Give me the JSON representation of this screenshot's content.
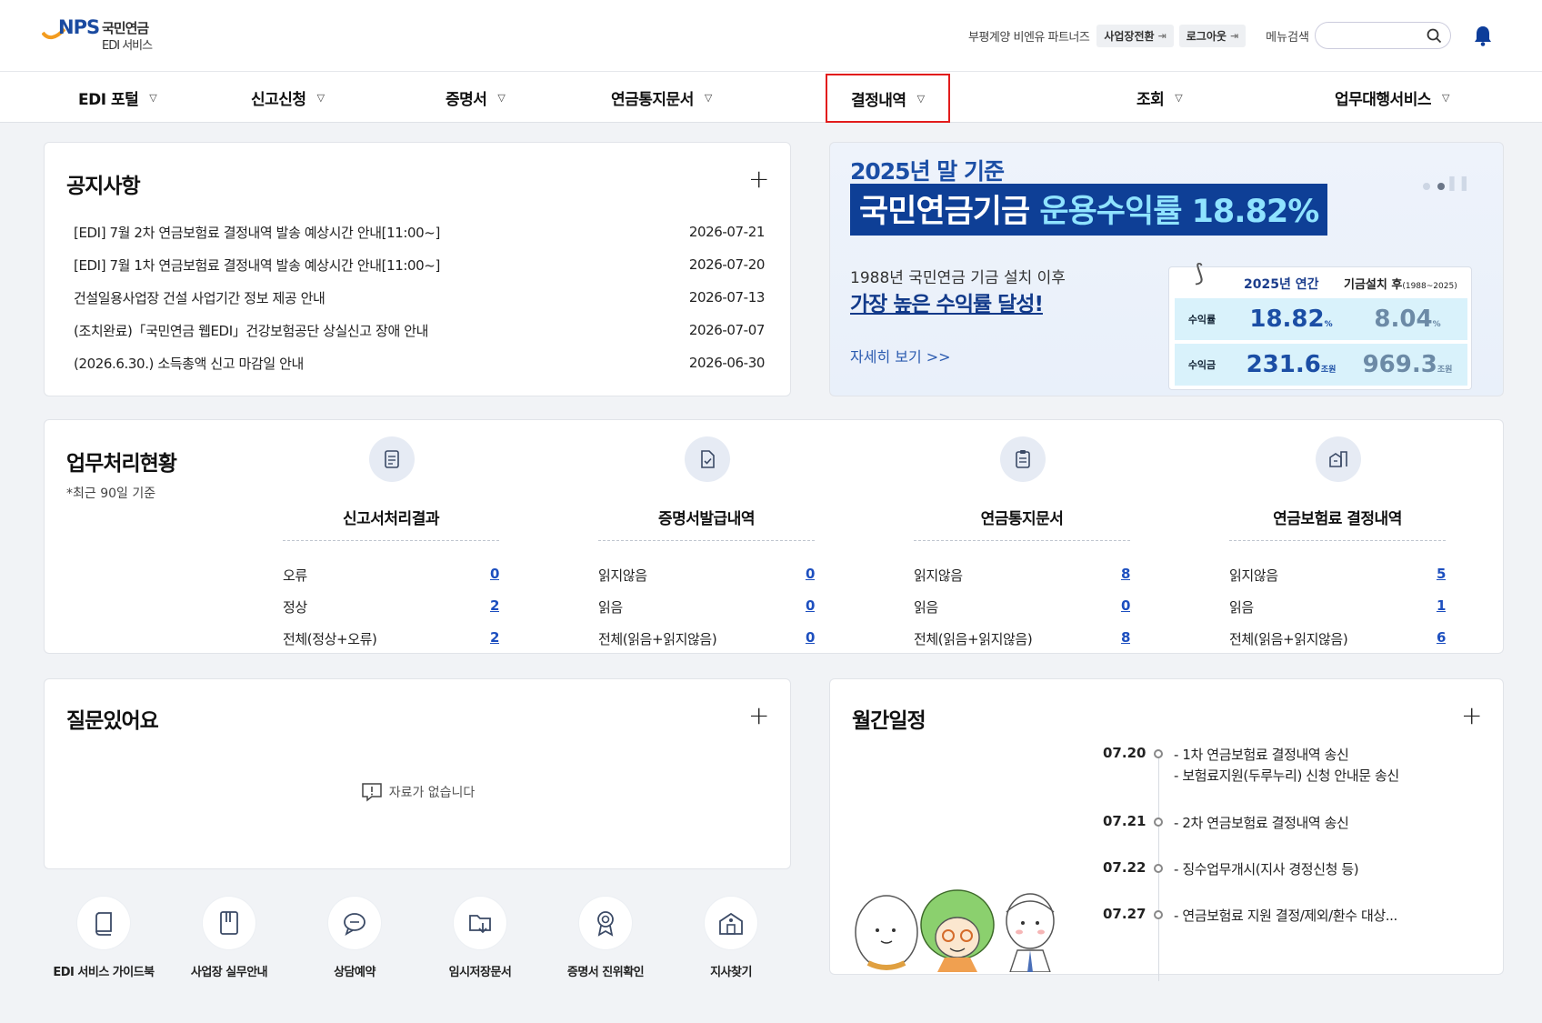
{
  "header": {
    "logo_brand": "NPS",
    "logo_name": "국민연금",
    "logo_sub": "EDI 서비스",
    "user_label": "부평계양 비엔유 파트너즈",
    "switch_workplace": "사업장전환",
    "logout": "로그아웃",
    "menu_search_label": "메뉴검색",
    "search_placeholder": ""
  },
  "nav": {
    "items": [
      {
        "label": "EDI 포털"
      },
      {
        "label": "신고신청"
      },
      {
        "label": "증명서"
      },
      {
        "label": "연금통지문서"
      },
      {
        "label": "결정내역"
      },
      {
        "label": "조회"
      },
      {
        "label": "업무대행서비스"
      }
    ],
    "active_index": 4
  },
  "notice": {
    "title": "공지사항",
    "items": [
      {
        "text": "[EDI] 7월 2차 연금보험료 결정내역 발송 예상시간 안내[11:00~]",
        "date": "2026-07-21"
      },
      {
        "text": "[EDI] 7월 1차 연금보험료 결정내역 발송 예상시간 안내[11:00~]",
        "date": "2026-07-20"
      },
      {
        "text": "건설일용사업장 건설 사업기간 정보 제공 안내",
        "date": "2026-07-13"
      },
      {
        "text": "(조치완료)「국민연금 웹EDI」건강보험공단 상실신고 장애 안내",
        "date": "2026-07-07"
      },
      {
        "text": "(2026.6.30.) 소득총액 신고 마감일 안내",
        "date": "2026-06-30"
      }
    ]
  },
  "banner": {
    "top": "2025년 말 기준",
    "head_a": "국민연금기금 ",
    "head_b": "운용수익률 18.82%",
    "sub": "1988년 국민연금 기금 설치 이후",
    "big": "가장 높은 수익률 달성!",
    "more": "자세히 보기 >>",
    "stat_h1": "2025년 연간",
    "stat_h2": "기금설치 후",
    "stat_h2_small": "(1988~2025)",
    "rows": [
      {
        "label": "수익률",
        "v1": "18.82",
        "u1": "%",
        "v2": "8.04",
        "u2": "%"
      },
      {
        "label": "수익금",
        "v1": "231.6",
        "u1": "조원",
        "v2": "969.3",
        "u2": "조원"
      }
    ]
  },
  "status": {
    "title": "업무처리현황",
    "sub": "*최근 90일 기준",
    "columns": [
      {
        "title": "신고서처리결과",
        "rows": [
          {
            "k": "오류",
            "v": "0"
          },
          {
            "k": "정상",
            "v": "2"
          },
          {
            "k": "전체(정상+오류)",
            "v": "2"
          }
        ]
      },
      {
        "title": "증명서발급내역",
        "rows": [
          {
            "k": "읽지않음",
            "v": "0"
          },
          {
            "k": "읽음",
            "v": "0"
          },
          {
            "k": "전체(읽음+읽지않음)",
            "v": "0"
          }
        ]
      },
      {
        "title": "연금통지문서",
        "rows": [
          {
            "k": "읽지않음",
            "v": "8"
          },
          {
            "k": "읽음",
            "v": "0"
          },
          {
            "k": "전체(읽음+읽지않음)",
            "v": "8"
          }
        ]
      },
      {
        "title": "연금보험료 결정내역",
        "rows": [
          {
            "k": "읽지않음",
            "v": "5"
          },
          {
            "k": "읽음",
            "v": "1"
          },
          {
            "k": "전체(읽음+읽지않음)",
            "v": "6"
          }
        ]
      }
    ]
  },
  "qna": {
    "title": "질문있어요",
    "empty": "자료가 없습니다"
  },
  "quick_links": [
    {
      "label": "EDI 서비스 가이드북",
      "icon": "book-icon"
    },
    {
      "label": "사업장 실무안내",
      "icon": "manual-icon"
    },
    {
      "label": "상담예약",
      "icon": "chat-icon"
    },
    {
      "label": "임시저장문서",
      "icon": "temp-save-icon"
    },
    {
      "label": "증명서 진위확인",
      "icon": "certificate-icon"
    },
    {
      "label": "지사찾기",
      "icon": "branch-icon"
    }
  ],
  "schedule": {
    "title": "월간일정",
    "items": [
      {
        "date": "07.20",
        "lines": [
          "1차 연금보험료 결정내역 송신",
          "보험료지원(두루누리) 신청 안내문 송신"
        ]
      },
      {
        "date": "07.21",
        "lines": [
          "2차 연금보험료 결정내역 송신"
        ]
      },
      {
        "date": "07.22",
        "lines": [
          "징수업무개시(지사 경정신청 등)"
        ]
      },
      {
        "date": "07.27",
        "lines": [
          "연금보험료 지원 결정/제외/환수 대상..."
        ]
      }
    ]
  },
  "colors": {
    "brand_blue": "#1b4ea5",
    "active_border": "#e21c1c",
    "link_blue": "#1d4fbf"
  }
}
